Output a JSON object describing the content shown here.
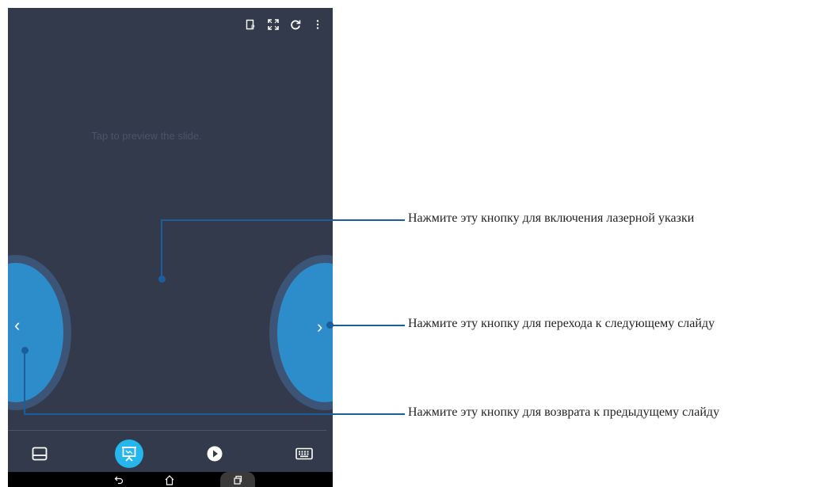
{
  "screen": {
    "preview_hint": "Tap to preview the slide.",
    "toolbar_icons": [
      "laser-pointer-icon",
      "fullscreen-icon",
      "refresh-icon",
      "more-vertical-icon"
    ],
    "nav_prev_label": "‹",
    "nav_next_label": "›",
    "bottom_tabs": [
      {
        "name": "touchpad",
        "icon": "touchpad-icon",
        "active": false
      },
      {
        "name": "presentation",
        "icon": "presentation-icon",
        "active": true
      },
      {
        "name": "play",
        "icon": "play-icon",
        "active": false
      },
      {
        "name": "keyboard",
        "icon": "keyboard-icon",
        "active": false
      }
    ],
    "system_nav": [
      "back-icon",
      "home-icon",
      "recents-icon"
    ]
  },
  "callouts": [
    {
      "text": "Нажмите эту кнопку для включения лазерной указки"
    },
    {
      "text": "Нажмите эту кнопку для перехода к следующему слайду"
    },
    {
      "text": "Нажмите эту кнопку для возврата к предыдущему слайду"
    }
  ],
  "colors": {
    "screen_bg": "#323a4c",
    "nav_button": "#2d8dcb",
    "nav_ring": "#3c5577",
    "active_tab": "#25b7ec",
    "callout_line": "#1c5d9c"
  }
}
